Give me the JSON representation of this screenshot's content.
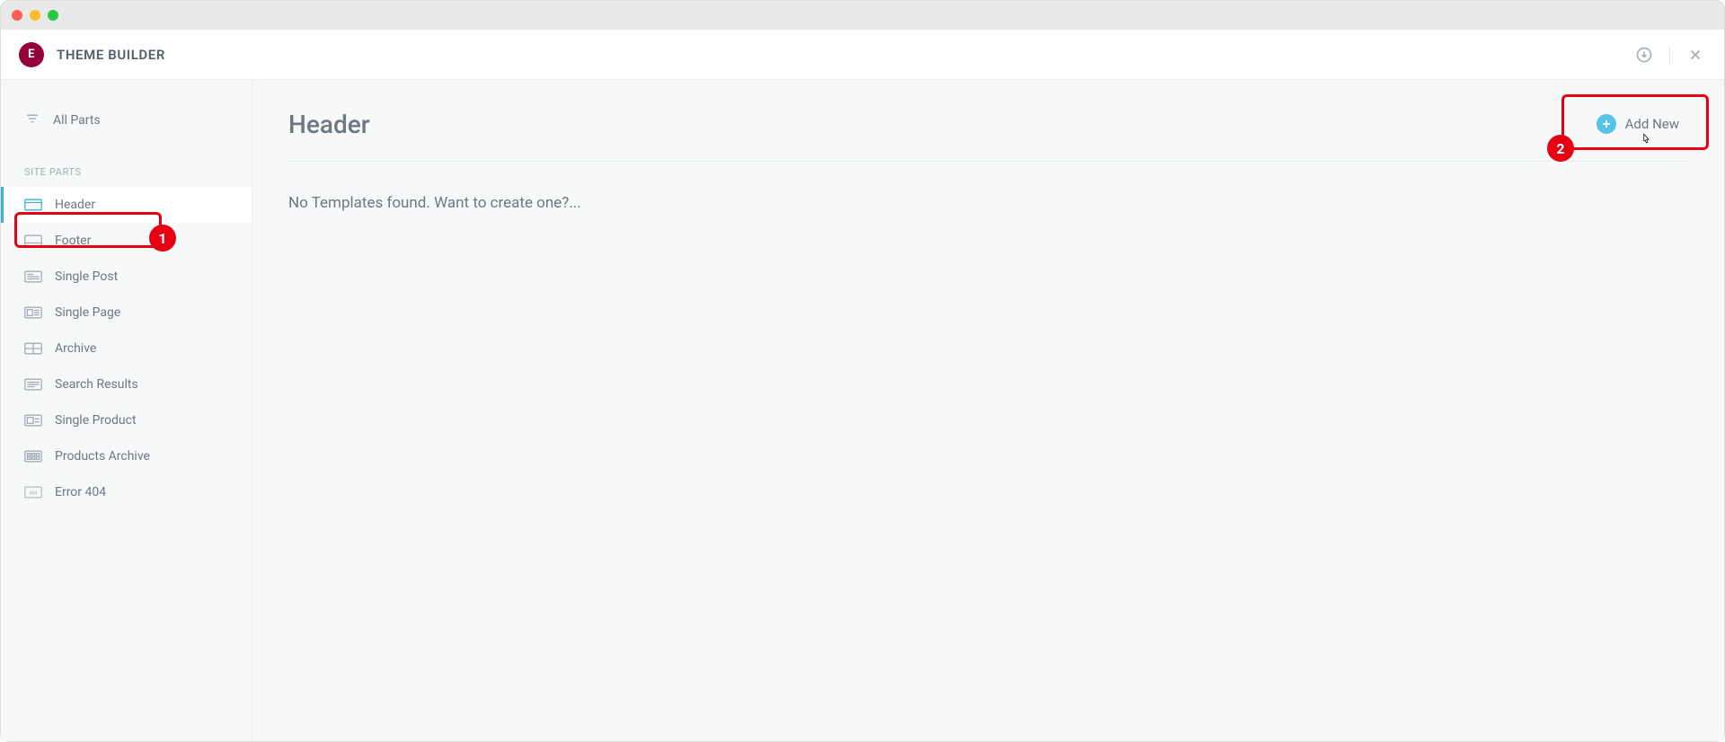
{
  "app": {
    "title": "THEME BUILDER"
  },
  "sidebar": {
    "all_parts": "All Parts",
    "section_label": "SITE PARTS",
    "items": [
      {
        "label": "Header",
        "active": true
      },
      {
        "label": "Footer"
      },
      {
        "label": "Single Post"
      },
      {
        "label": "Single Page"
      },
      {
        "label": "Archive"
      },
      {
        "label": "Search Results"
      },
      {
        "label": "Single Product"
      },
      {
        "label": "Products Archive"
      },
      {
        "label": "Error 404"
      }
    ]
  },
  "main": {
    "title": "Header",
    "add_new_label": "Add New",
    "empty_message": "No Templates found. Want to create one?..."
  },
  "annotations": {
    "badge1": "1",
    "badge2": "2"
  }
}
